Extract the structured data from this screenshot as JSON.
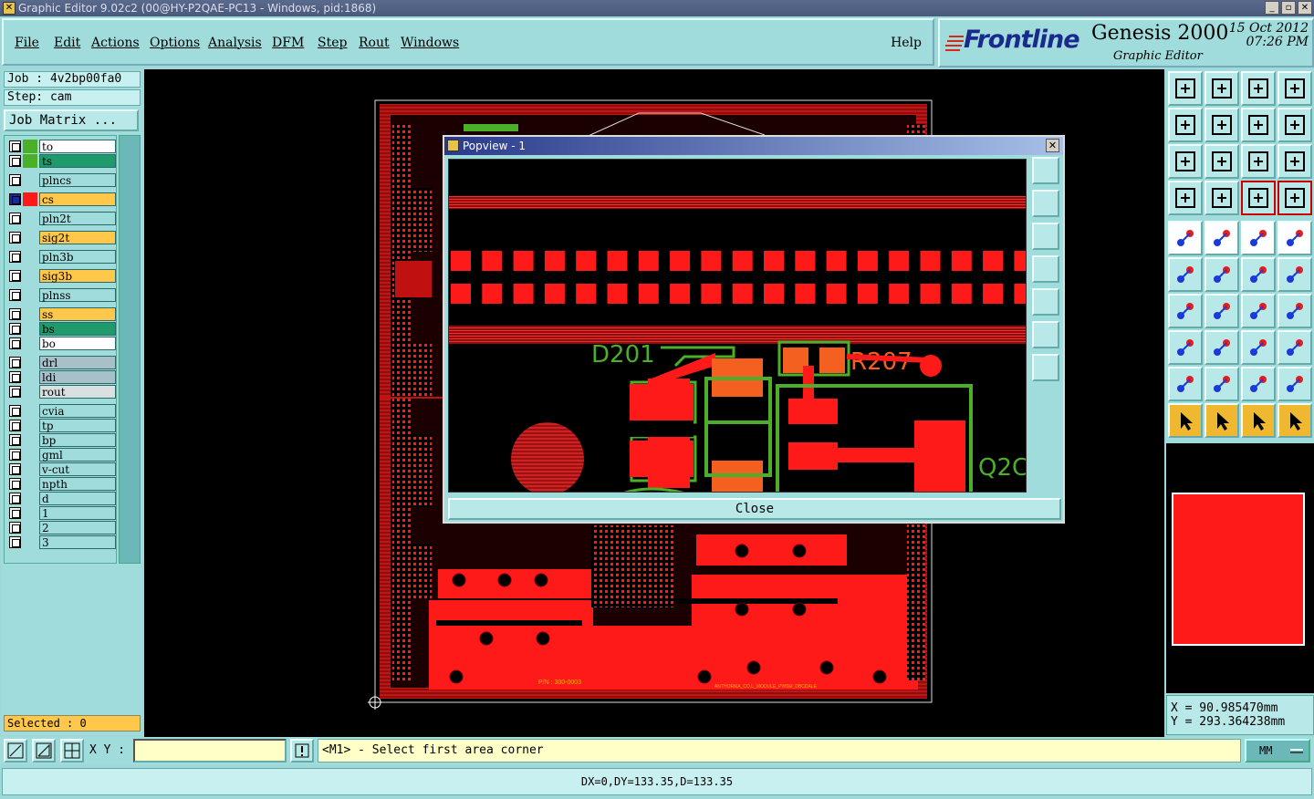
{
  "window": {
    "title": "Graphic Editor 9.02c2 (00@HY-P2QAE-PC13 - Windows, pid:1868)",
    "buttons": [
      "_",
      "▫",
      "✕"
    ]
  },
  "menubar": {
    "items": [
      "File",
      "Edit",
      "Actions",
      "Options",
      "Analysis",
      "DFM",
      "Step",
      "Rout",
      "Windows"
    ],
    "help": "Help"
  },
  "logo": {
    "brand": "Frontline",
    "product": "Genesis 2000",
    "subtitle": "Graphic Editor",
    "date": "15 Oct 2012",
    "time": "07:26 PM"
  },
  "job": {
    "job_label": "Job : 4v2bp00fa0",
    "step_label": "Step: cam",
    "matrix_button": "Job Matrix ..."
  },
  "layers": [
    {
      "name": "to",
      "color": "#4caf2a",
      "bg": "#ffffff"
    },
    {
      "name": "ts",
      "color": "#4caf2a",
      "bg": "#1f9a6a"
    },
    {
      "name": "plncs",
      "color": "#a0dcdc",
      "bg": "#a0dcdc"
    },
    {
      "name": "cs",
      "color": "#ff1a1a",
      "bg": "#ffc84a",
      "active": true
    },
    {
      "name": "pln2t",
      "color": "#a0dcdc",
      "bg": "#a0dcdc"
    },
    {
      "name": "sig2t",
      "color": "#a0dcdc",
      "bg": "#ffc84a"
    },
    {
      "name": "pln3b",
      "color": "#a0dcdc",
      "bg": "#a0dcdc"
    },
    {
      "name": "sig3b",
      "color": "#a0dcdc",
      "bg": "#ffc84a"
    },
    {
      "name": "plnss",
      "color": "#a0dcdc",
      "bg": "#a0dcdc"
    },
    {
      "name": "ss",
      "color": "#a0dcdc",
      "bg": "#ffc84a"
    },
    {
      "name": "bs",
      "color": "#a0dcdc",
      "bg": "#1f9a6a"
    },
    {
      "name": "bo",
      "color": "#a0dcdc",
      "bg": "#ffffff"
    },
    {
      "name": "drl",
      "color": "#a0dcdc",
      "bg": "#a8c0c8"
    },
    {
      "name": "ldi",
      "color": "#a0dcdc",
      "bg": "#a8c0c8"
    },
    {
      "name": "rout",
      "color": "#a0dcdc",
      "bg": "#d8e0e0"
    },
    {
      "name": "cvia",
      "color": "#a0dcdc",
      "bg": "#a0dcdc"
    },
    {
      "name": "tp",
      "color": "#a0dcdc",
      "bg": "#a0dcdc"
    },
    {
      "name": "bp",
      "color": "#a0dcdc",
      "bg": "#a0dcdc"
    },
    {
      "name": "gml",
      "color": "#a0dcdc",
      "bg": "#a0dcdc"
    },
    {
      "name": "v-cut",
      "color": "#a0dcdc",
      "bg": "#a0dcdc"
    },
    {
      "name": "npth",
      "color": "#a0dcdc",
      "bg": "#a0dcdc"
    },
    {
      "name": "d",
      "color": "#a0dcdc",
      "bg": "#a0dcdc"
    },
    {
      "name": "1",
      "color": "#a0dcdc",
      "bg": "#a0dcdc"
    },
    {
      "name": "2",
      "color": "#a0dcdc",
      "bg": "#a0dcdc"
    },
    {
      "name": "3",
      "color": "#a0dcdc",
      "bg": "#a0dcdc"
    }
  ],
  "selected": "Selected : 0",
  "popview": {
    "title": "Popview - 1",
    "close_label": "Close",
    "labels": {
      "d201": "D201",
      "r207": "R207",
      "q2": "Q2C"
    }
  },
  "board": {
    "pn": "P/N : 300-0003",
    "id": "ANTHORMA_CO.L_MODULE_PWSM_DBCDALE"
  },
  "coords": {
    "x": "X = 90.985470mm",
    "y": "Y = 293.364238mm"
  },
  "bottom": {
    "xy_label": "X Y :",
    "xy_value": "",
    "prompt": "<M1> - Select first area corner",
    "units": "MM",
    "status": "DX=0,DY=133.35,D=133.35"
  },
  "colors": {
    "copper": "#ff1a1a",
    "silk": "#4caf2a",
    "panel": "#a0dcdc"
  }
}
